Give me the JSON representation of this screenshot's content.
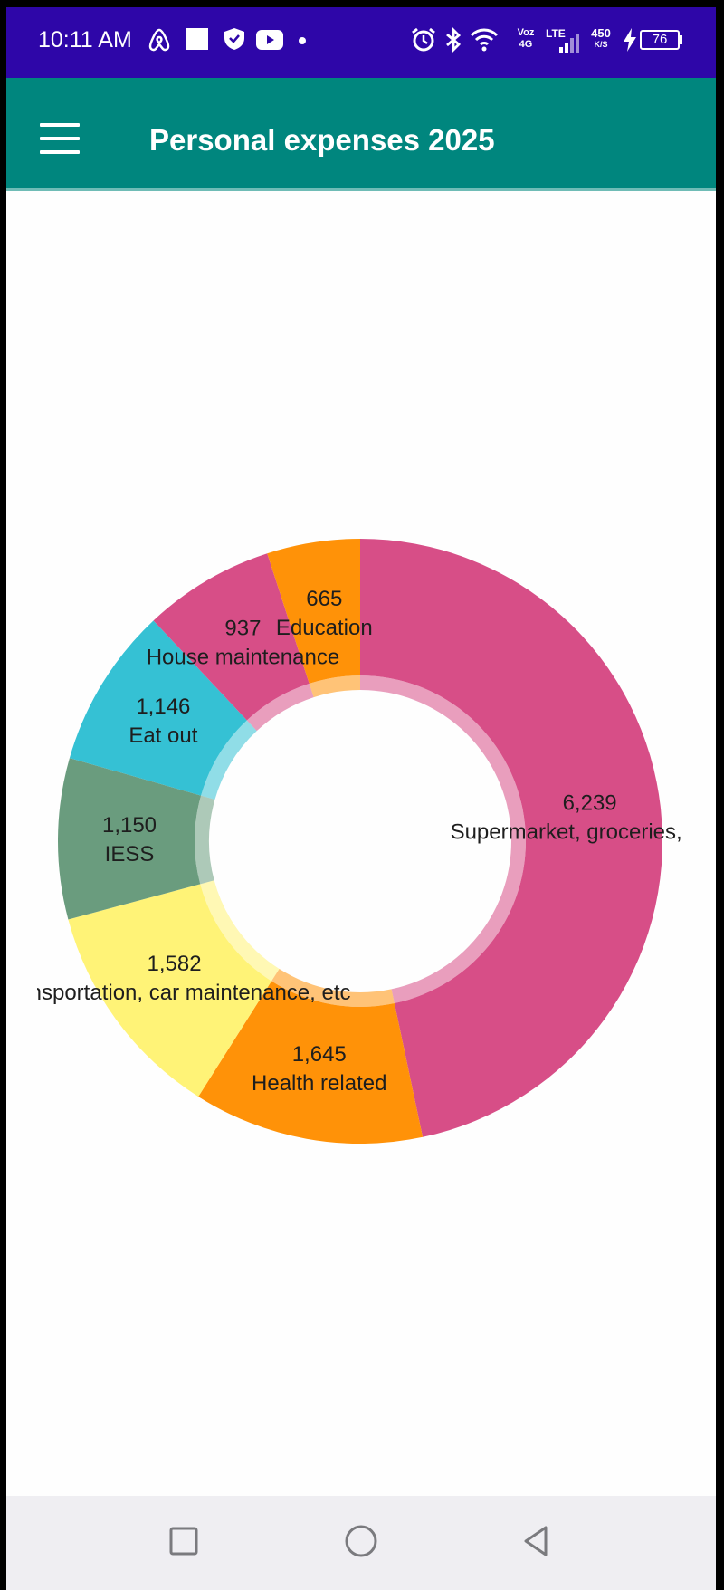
{
  "status_bar": {
    "time": "10:11 AM",
    "battery_level": "76",
    "network_speed": "450",
    "network_speed_unit": "K/S",
    "lte_label": "LTE",
    "voz_label": "Voz",
    "g4_label": "4G",
    "left_icons": [
      "airbnb-icon",
      "square-notification-icon",
      "shield-icon",
      "youtube-icon",
      "dot-icon"
    ],
    "right_icons": [
      "alarm-icon",
      "bluetooth-icon",
      "wifi-icon",
      "signal-icon",
      "charging-icon",
      "battery-icon"
    ]
  },
  "app_bar": {
    "title": "Personal expenses 2025",
    "menu_icon": "hamburger-menu-icon"
  },
  "chart_data": {
    "type": "pie",
    "donut": true,
    "slices": [
      {
        "label": "Supermarket, groceries, item",
        "value": 6239,
        "value_text": "6,239",
        "color": "#d74e87"
      },
      {
        "label": "Health related",
        "value": 1645,
        "value_text": "1,645",
        "color": "#ff9208"
      },
      {
        "label": "Transportation, car maintenance, etc",
        "value": 1582,
        "value_text": "1,582",
        "color": "#fff377"
      },
      {
        "label": "IESS",
        "value": 1150,
        "value_text": "1,150",
        "color": "#6a9c7e"
      },
      {
        "label": "Eat out",
        "value": 1146,
        "value_text": "1,146",
        "color": "#35c1d4"
      },
      {
        "label": "House maintenance",
        "value": 937,
        "value_text": "937",
        "color": "#d74e87"
      },
      {
        "label": "Education",
        "value": 665,
        "value_text": "665",
        "color": "#ff9208"
      }
    ]
  },
  "nav_bar": {
    "recents_icon": "square-recents-icon",
    "home_icon": "circle-home-icon",
    "back_icon": "triangle-back-icon"
  }
}
